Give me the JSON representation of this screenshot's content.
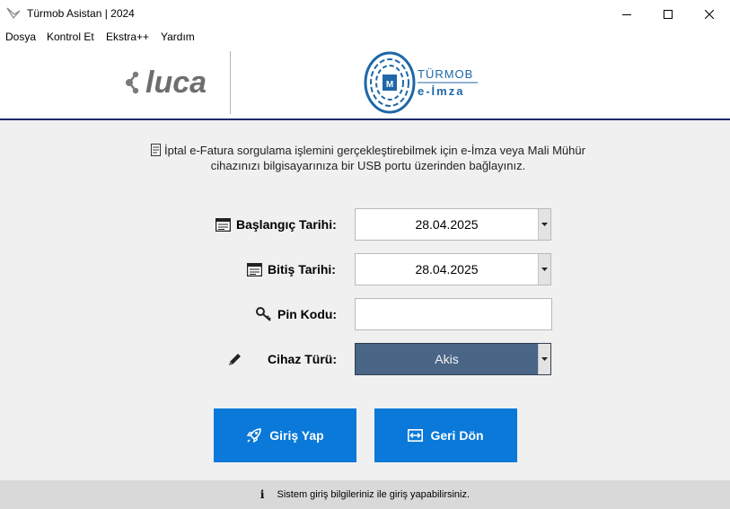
{
  "window": {
    "title": "Türmob Asistan | 2024"
  },
  "menu": [
    "Dosya",
    "Kontrol Et",
    "Ekstra++",
    "Yardım"
  ],
  "header": {
    "luca_logo_text": "luca",
    "turmob_logo_line1": "TÜRMOB",
    "turmob_logo_line2": "e-İmza"
  },
  "info": {
    "line1": "İptal e-Fatura sorgulama işlemini gerçekleştirebilmek için e-İmza veya Mali Mühür",
    "line2": "cihazınızı bilgisayarınıza bir USB portu üzerinden bağlayınız."
  },
  "form": {
    "start_label": "Başlangıç Tarihi:",
    "start_value": "28.04.2025",
    "end_label": "Bitiş Tarihi:",
    "end_value": "28.04.2025",
    "pin_label": "Pin Kodu:",
    "pin_value": "",
    "device_label": "Cihaz Türü:",
    "device_value": "Akis"
  },
  "buttons": {
    "login": "Giriş Yap",
    "back": "Geri Dön"
  },
  "status": {
    "text": "Sistem giriş bilgileriniz ile giriş yapabilirsiniz."
  },
  "colors": {
    "primary_button": "#0a79d9",
    "header_rule": "#1b2a6b",
    "device_combo": "#4a6585",
    "status_bar": "#d9d9d9"
  }
}
